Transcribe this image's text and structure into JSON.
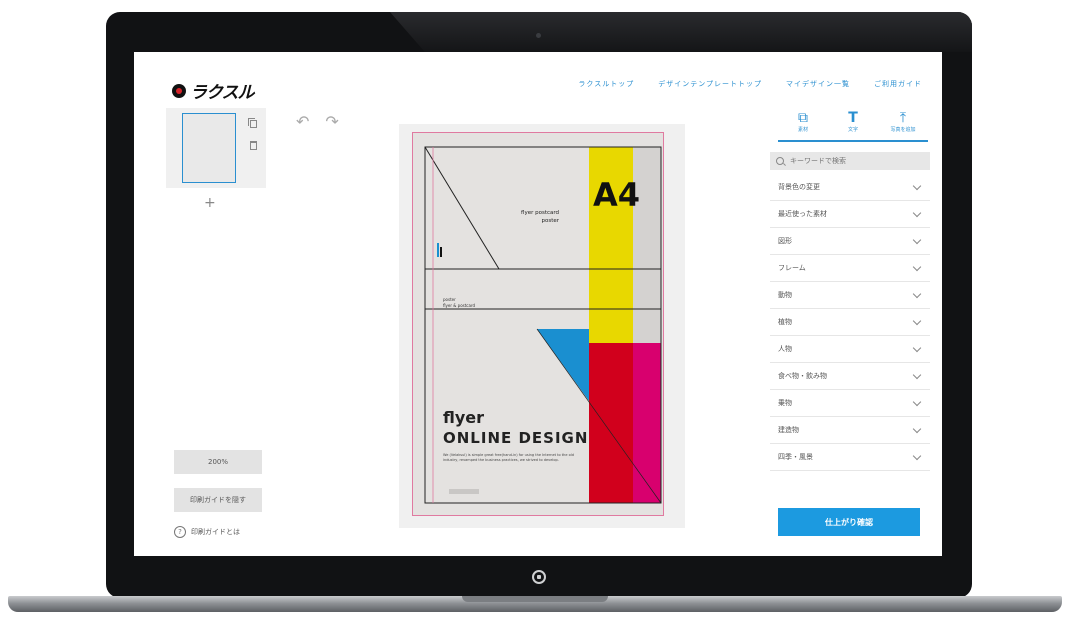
{
  "app": {
    "logo_text": "ラクスル"
  },
  "nav": {
    "items": [
      "ラクスルトップ",
      "デザインテンプレートトップ",
      "マイデザイン一覧",
      "ご利用ガイド"
    ]
  },
  "editor": {
    "add_page": "+",
    "zoom": "200%",
    "guide_toggle": "印刷ガイドを隠す",
    "guide_help": "印刷ガイドとは",
    "help_mark": "?"
  },
  "poster": {
    "a4": "A4",
    "sub_line1": "flyer postcard",
    "sub_line2": "poster",
    "small_line1": "poster",
    "small_line2": "flyer & postcard",
    "flyer": "flyer",
    "title": "ONLINE DESIGN",
    "body": "We (Velaksul) is simple great free(hand-in) for using the Internet to the old industry, revamped the business practices, we strived to develop."
  },
  "tools": {
    "tabs": [
      {
        "icon": "shape-icon",
        "label": "素材"
      },
      {
        "icon": "text-icon",
        "label": "文字"
      },
      {
        "icon": "upload-icon",
        "label": "写真を追加"
      }
    ],
    "search_placeholder": "キーワードで検索",
    "categories": [
      "背景色の変更",
      "最近使った素材",
      "図形",
      "フレーム",
      "動物",
      "植物",
      "人物",
      "食べ物・飲み物",
      "乗物",
      "建造物",
      "四季・風景"
    ],
    "confirm_button": "仕上がり確認"
  },
  "colors": {
    "accent": "#1c9ae0",
    "poster_yellow": "#e8d800",
    "poster_red": "#d1001c",
    "poster_magenta": "#d8006e",
    "poster_blue": "#1a8fd0"
  }
}
